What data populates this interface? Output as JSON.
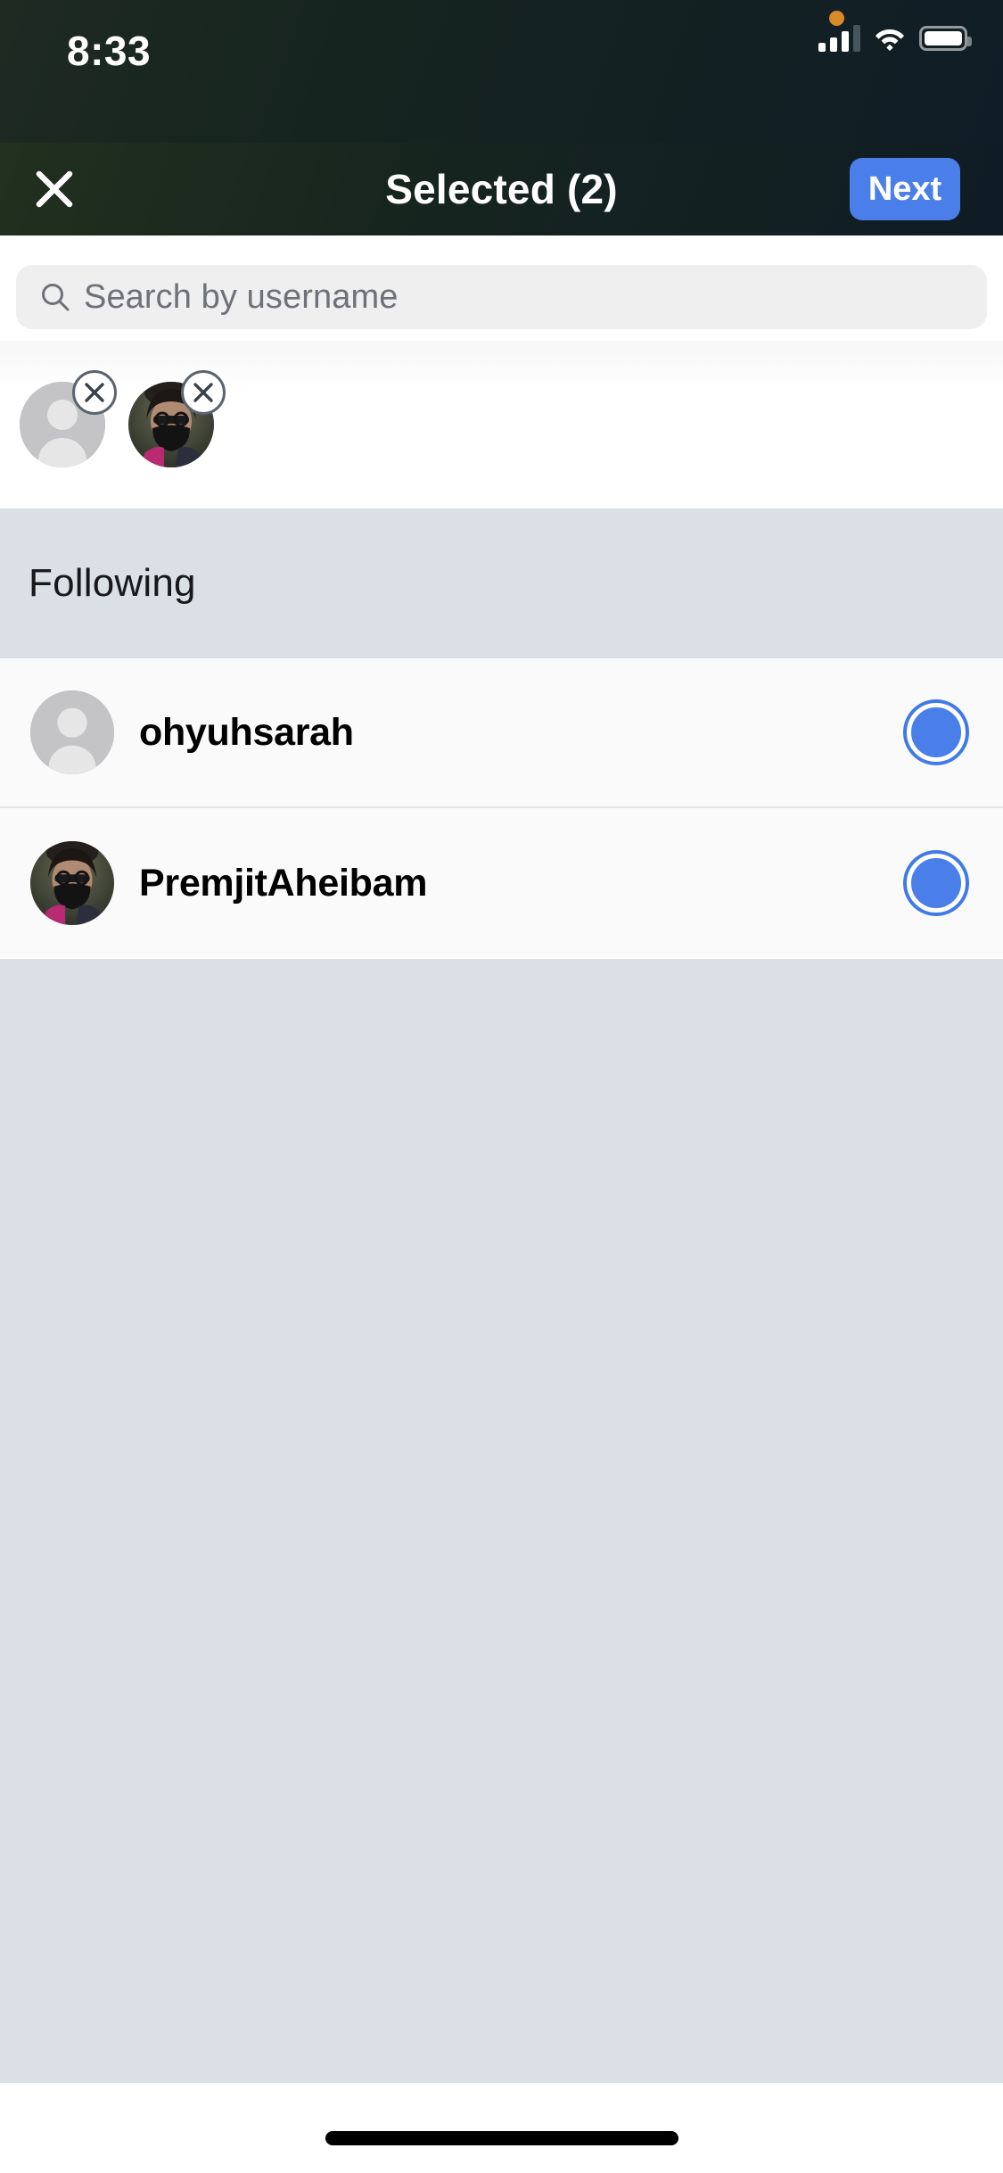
{
  "status_bar": {
    "time": "8:33",
    "icons": {
      "recording_dot": "orange-dot-icon",
      "signal": "cellular-signal-icon",
      "signal_bars_filled": 3,
      "signal_bars_total": 4,
      "wifi": "wifi-icon",
      "battery": "battery-icon",
      "battery_level": 100
    },
    "colors": {
      "background": "#16241f",
      "foreground": "#ffffff",
      "dot": "#d98a28"
    }
  },
  "nav_bar": {
    "close_icon": "close-icon",
    "title": "Selected (2)",
    "next_label": "Next",
    "accent": "#4a7fea"
  },
  "search": {
    "icon": "search-icon",
    "placeholder": "Search by username",
    "value": "",
    "background": "#efeff0"
  },
  "selected_chips": {
    "remove_icon": "close-icon",
    "items": [
      {
        "name": "ohyuhsarah",
        "avatar_type": "placeholder",
        "remove_label": "Remove ohyuhsarah"
      },
      {
        "name": "PremjitAheibam",
        "avatar_type": "photo",
        "remove_label": "Remove PremjitAheibam"
      }
    ]
  },
  "section": {
    "header": "Following",
    "header_background": "#dbdfe6"
  },
  "user_list": {
    "rows": [
      {
        "username": "ohyuhsarah",
        "avatar_type": "placeholder",
        "selected": true
      },
      {
        "username": "PremjitAheibam",
        "avatar_type": "photo",
        "selected": true
      }
    ],
    "selected_color": "#4a7fea",
    "row_background": "#fafafa"
  },
  "home_indicator": {
    "name": "home-indicator",
    "color": "#000000"
  }
}
